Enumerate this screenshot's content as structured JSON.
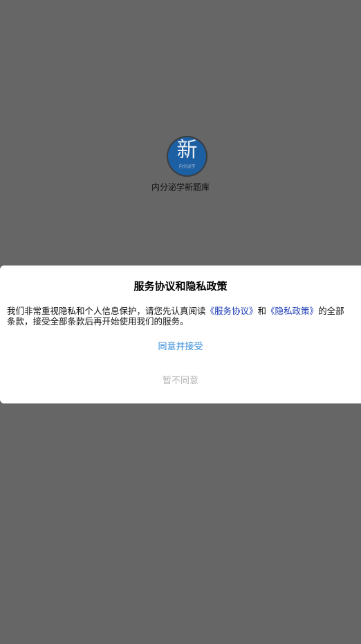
{
  "splash": {
    "logo_char": "新",
    "logo_subtext": "内分泌学",
    "app_name": "内分泌学新题库"
  },
  "dialog": {
    "title": "服务协议和隐私政策",
    "body_prefix": "我们非常重视隐私和个人信息保护，请您先认真阅读",
    "service_link": "《服务协议》",
    "conjunction": "和",
    "privacy_link": "《隐私政策》",
    "body_suffix_line1": "的全部",
    "body_line2": "条款，接受全部条款后再开始使用我们的服务。",
    "agree_label": "同意并接受",
    "disagree_label": "暂不同意"
  },
  "colors": {
    "backdrop": "#666666",
    "link": "#1a3bb5",
    "agree": "#2f8ad7",
    "disagree": "#b3b3b3",
    "logo": "#1c5fa3"
  }
}
